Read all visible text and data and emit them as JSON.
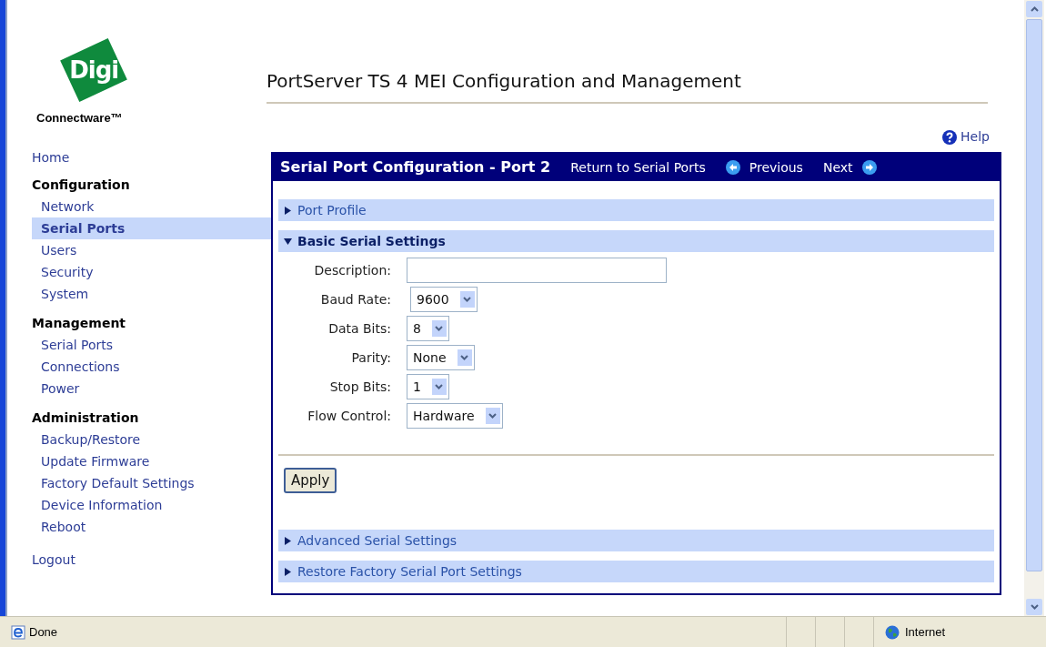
{
  "logo": {
    "mark": "Digi",
    "wordmark": "Connectware™"
  },
  "page_title": "PortServer TS 4 MEI Configuration and Management",
  "help_link": "Help",
  "sidebar": [
    {
      "kind": "link",
      "label": "Home",
      "selected": false
    },
    {
      "kind": "group",
      "label": "Configuration",
      "children": [
        {
          "label": "Network",
          "selected": false
        },
        {
          "label": "Serial Ports",
          "selected": true
        },
        {
          "label": "Users",
          "selected": false
        },
        {
          "label": "Security",
          "selected": false
        },
        {
          "label": "System",
          "selected": false
        }
      ]
    },
    {
      "kind": "group",
      "label": "Management",
      "children": [
        {
          "label": "Serial Ports",
          "selected": false
        },
        {
          "label": "Connections",
          "selected": false
        },
        {
          "label": "Power",
          "selected": false
        }
      ]
    },
    {
      "kind": "group",
      "label": "Administration",
      "children": [
        {
          "label": "Backup/Restore",
          "selected": false
        },
        {
          "label": "Update Firmware",
          "selected": false
        },
        {
          "label": "Factory Default Settings",
          "selected": false
        },
        {
          "label": "Device Information",
          "selected": false
        },
        {
          "label": "Reboot",
          "selected": false
        }
      ]
    },
    {
      "kind": "link",
      "label": "Logout",
      "selected": false
    }
  ],
  "panel": {
    "title": "Serial Port Configuration - Port 2",
    "return_link": "Return to Serial Ports",
    "previous_link": "Previous",
    "next_link": "Next",
    "sections": [
      {
        "label": "Port Profile",
        "expanded": false
      },
      {
        "label": "Basic Serial Settings",
        "expanded": true,
        "fields": [
          {
            "kind": "text",
            "label": "Description:"
          },
          {
            "kind": "select",
            "label": "Baud Rate:",
            "value": "9600"
          },
          {
            "kind": "select",
            "label": "Data Bits:",
            "value": "8"
          },
          {
            "kind": "select",
            "label": "Parity:",
            "value": "None"
          },
          {
            "kind": "select",
            "label": "Stop Bits:",
            "value": "1"
          },
          {
            "kind": "select",
            "label": "Flow Control:",
            "value": "Hardware"
          }
        ],
        "button": "Apply"
      },
      {
        "label": "Advanced Serial Settings",
        "expanded": false
      },
      {
        "label": "Restore Factory Serial Port Settings",
        "expanded": false
      }
    ]
  },
  "status_bar": {
    "status": "Done",
    "zone": "Internet"
  }
}
